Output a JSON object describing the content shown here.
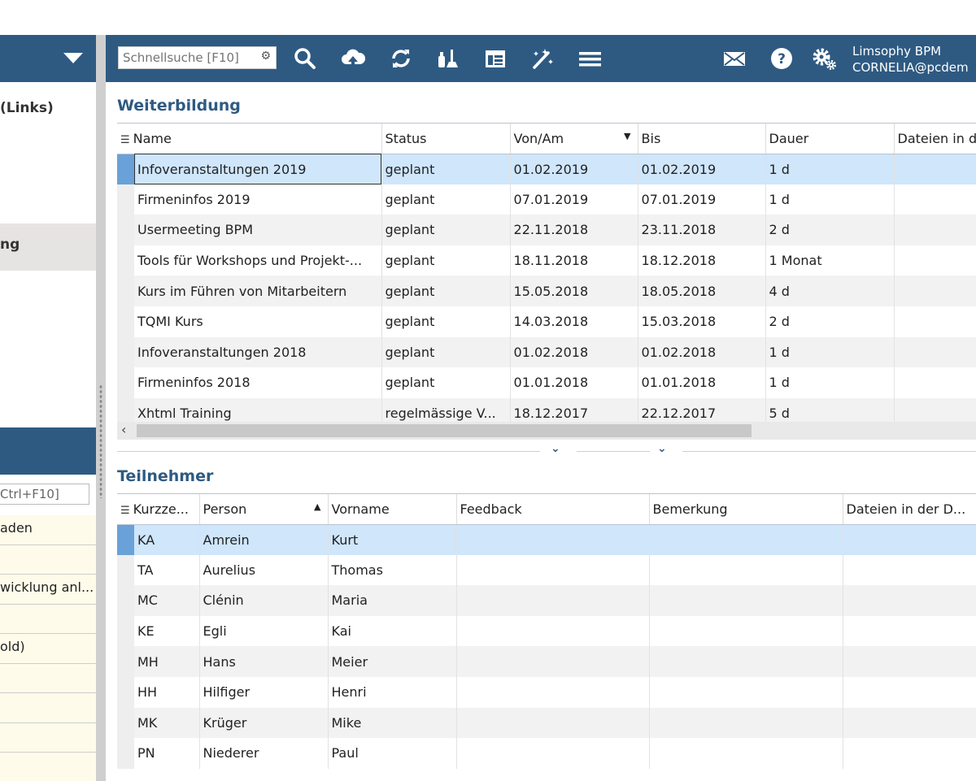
{
  "left_panel": {
    "title_fragment": "(Links)",
    "selected_fragment": "ng",
    "search_placeholder": "Ctrl+F10]",
    "items": [
      "aden",
      "",
      "wicklung anl...",
      "",
      "old)",
      "",
      "",
      ""
    ]
  },
  "toolbar": {
    "search_placeholder": "Schnellsuche [F10]",
    "icons": [
      "search-icon",
      "cloud-upload-icon",
      "refresh-icon",
      "clean-icon",
      "layout-icon",
      "magic-wand-icon",
      "menu-icon",
      "mail-icon",
      "help-icon",
      "settings-icon"
    ],
    "user_app": "Limsophy BPM",
    "user_name": "CORNELIA@pcdem"
  },
  "weiterbildung": {
    "title": "Weiterbildung",
    "columns": [
      "Name",
      "Status",
      "Von/Am",
      "Bis",
      "Dauer",
      "Dateien in d"
    ],
    "rows": [
      [
        "Infoveranstaltungen 2019",
        "geplant",
        "01.02.2019",
        "01.02.2019",
        "1 d",
        ""
      ],
      [
        "Firmeninfos 2019",
        "geplant",
        "07.01.2019",
        "07.01.2019",
        "1 d",
        ""
      ],
      [
        "Usermeeting BPM",
        "geplant",
        "22.11.2018",
        "23.11.2018",
        "2 d",
        ""
      ],
      [
        "Tools für Workshops und Projekt-...",
        "geplant",
        "18.11.2018",
        "18.12.2018",
        "1 Monat",
        ""
      ],
      [
        "Kurs im Führen von Mitarbeitern",
        "geplant",
        "15.05.2018",
        "18.05.2018",
        "4 d",
        ""
      ],
      [
        "TQMI Kurs",
        "geplant",
        "14.03.2018",
        "15.03.2018",
        "2 d",
        ""
      ],
      [
        "Infoveranstaltungen 2018",
        "geplant",
        "01.02.2018",
        "01.02.2018",
        "1 d",
        ""
      ],
      [
        "Firmeninfos 2018",
        "geplant",
        "01.01.2018",
        "01.01.2018",
        "1 d",
        ""
      ],
      [
        "Xhtml Training",
        "regelmässige V...",
        "18.12.2017",
        "22.12.2017",
        "5 d",
        ""
      ]
    ]
  },
  "teilnehmer": {
    "title": "Teilnehmer",
    "columns": [
      "Kurzze...",
      "Person",
      "Vorname",
      "Feedback",
      "Bemerkung",
      "Dateien in der D..."
    ],
    "rows": [
      [
        "KA",
        "Amrein",
        "Kurt",
        "",
        "",
        ""
      ],
      [
        "TA",
        "Aurelius",
        "Thomas",
        "",
        "",
        ""
      ],
      [
        "MC",
        "Clénin",
        "Maria",
        "",
        "",
        ""
      ],
      [
        "KE",
        "Egli",
        "Kai",
        "",
        "",
        ""
      ],
      [
        "MH",
        "Hans",
        "Meier",
        "",
        "",
        ""
      ],
      [
        "HH",
        "Hilfiger",
        "Henri",
        "",
        "",
        ""
      ],
      [
        "MK",
        "Krüger",
        "Mike",
        "",
        "",
        ""
      ],
      [
        "PN",
        "Niederer",
        "Paul",
        "",
        "",
        ""
      ]
    ]
  },
  "colors": {
    "header_blue": "#2e5a82",
    "selection": "#cfe6fb",
    "row_alt": "#f2f2f2"
  }
}
